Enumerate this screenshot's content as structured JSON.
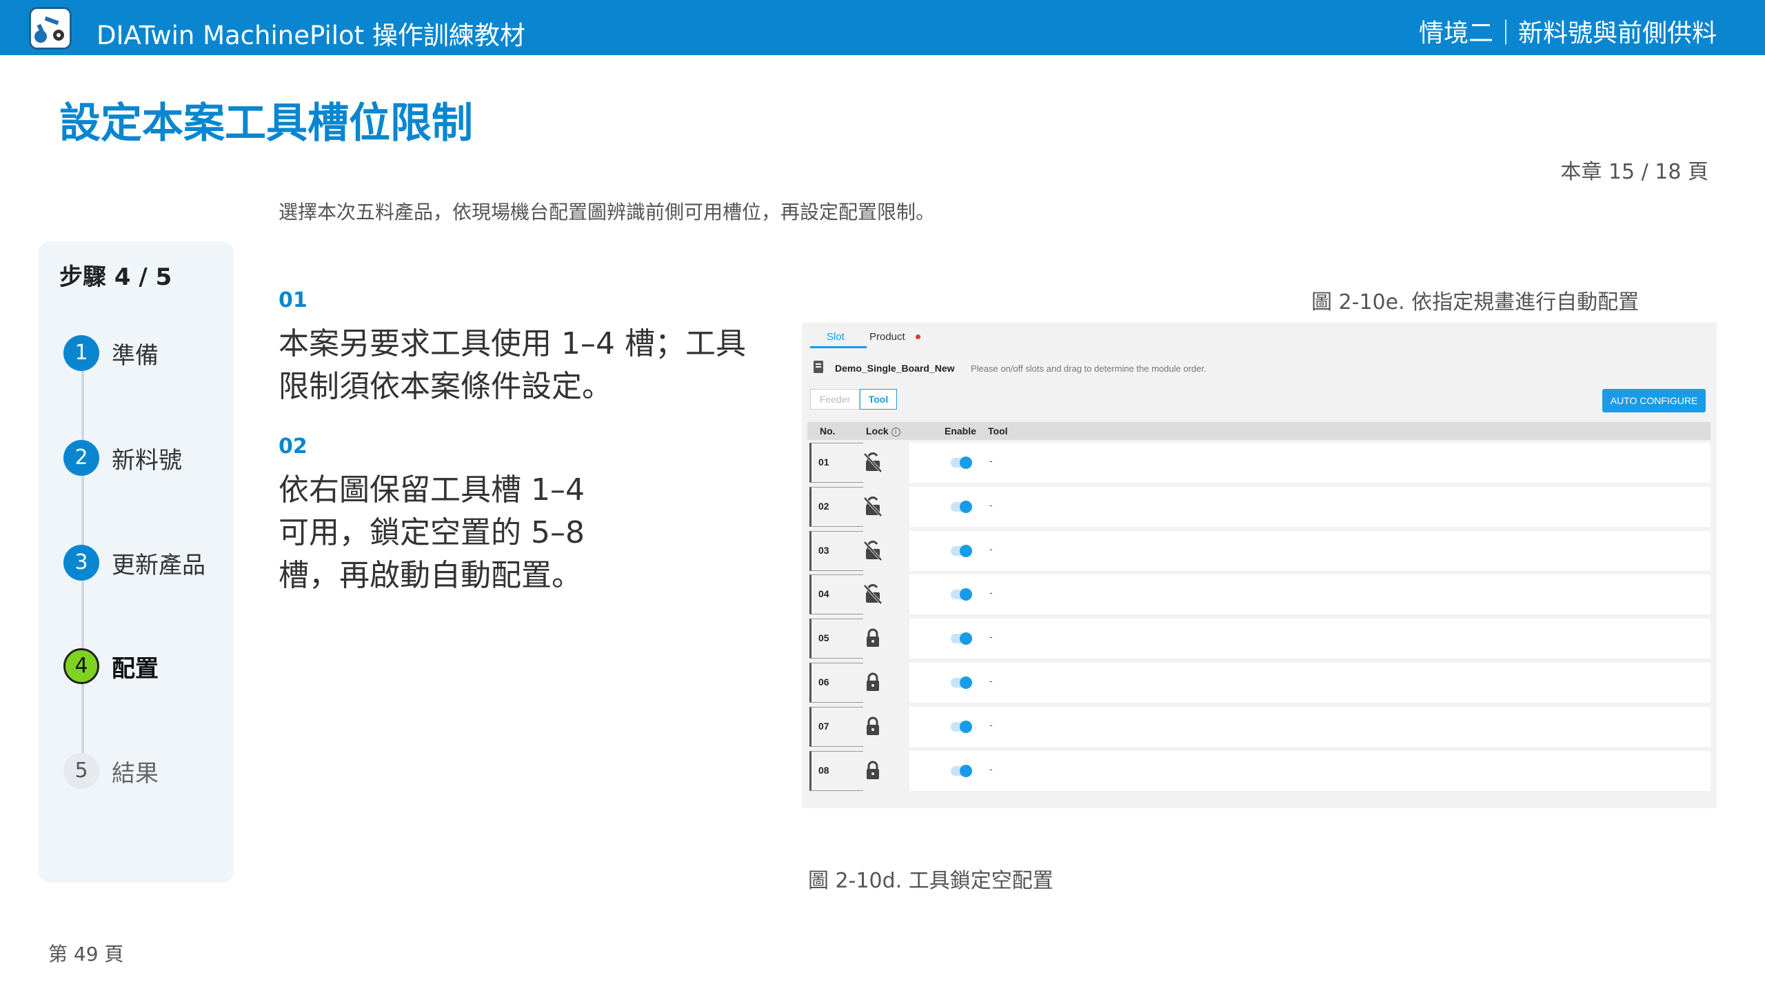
{
  "header": {
    "app_title": "DIATwin MachinePilot 操作訓練教材",
    "scene_title": "情境二｜新料號與前側供料",
    "logo_icon": "robot-arm-icon"
  },
  "page_title": "設定本案工具槽位限制",
  "chapter_page": "本章 15 / 18 頁",
  "intro": "選擇本次五料產品，依現場機台配置圖辨識前側可用槽位，再設定配置限制。",
  "steps": {
    "title": "步驟 4 / 5",
    "items": [
      {
        "num": "1",
        "label": "準備",
        "state": "done"
      },
      {
        "num": "2",
        "label": "新料號",
        "state": "done"
      },
      {
        "num": "3",
        "label": "更新產品",
        "state": "done"
      },
      {
        "num": "4",
        "label": "配置",
        "state": "active"
      },
      {
        "num": "5",
        "label": "結果",
        "state": "pending"
      }
    ]
  },
  "sections": [
    {
      "num": "01",
      "text": "本案另要求工具使用 1–4 槽；工具限制須依本案條件設定。"
    },
    {
      "num": "02",
      "text": "依右圖保留工具槽 1–4 可用，鎖定空置的 5–8 槽，再啟動自動配置。"
    }
  ],
  "captions": {
    "top": "圖 2-10e. 依指定規畫進行自動配置",
    "bottom": "圖 2-10d. 工具鎖定空配置"
  },
  "footer": "第 49 頁",
  "screenshot": {
    "tabs": [
      {
        "label": "Slot",
        "active": true
      },
      {
        "label": "Product",
        "active": false,
        "badge": "red-dot"
      }
    ],
    "board_name": "Demo_Single_Board_New",
    "board_hint": "Please on/off slots and drag to determine the module order.",
    "segments": {
      "feeder": "Feeder",
      "tool": "Tool",
      "selected": "Tool"
    },
    "auto_button": "AUTO CONFIGURE",
    "columns": {
      "no": "No.",
      "lock": "Lock",
      "lock_info": "i",
      "enable": "Enable",
      "tool": "Tool"
    },
    "rows": [
      {
        "no": "01",
        "lock": "unlocked",
        "enabled": true,
        "tool": "-"
      },
      {
        "no": "02",
        "lock": "unlocked",
        "enabled": true,
        "tool": "-"
      },
      {
        "no": "03",
        "lock": "unlocked",
        "enabled": true,
        "tool": "-"
      },
      {
        "no": "04",
        "lock": "unlocked",
        "enabled": true,
        "tool": "-"
      },
      {
        "no": "05",
        "lock": "locked",
        "enabled": true,
        "tool": "-"
      },
      {
        "no": "06",
        "lock": "locked",
        "enabled": true,
        "tool": "-"
      },
      {
        "no": "07",
        "lock": "locked",
        "enabled": true,
        "tool": "-"
      },
      {
        "no": "08",
        "lock": "locked",
        "enabled": true,
        "tool": "-"
      }
    ],
    "colors": {
      "accent": "#1a9be8",
      "header_blue": "#0a86d0",
      "active_step": "#7ed321"
    }
  }
}
